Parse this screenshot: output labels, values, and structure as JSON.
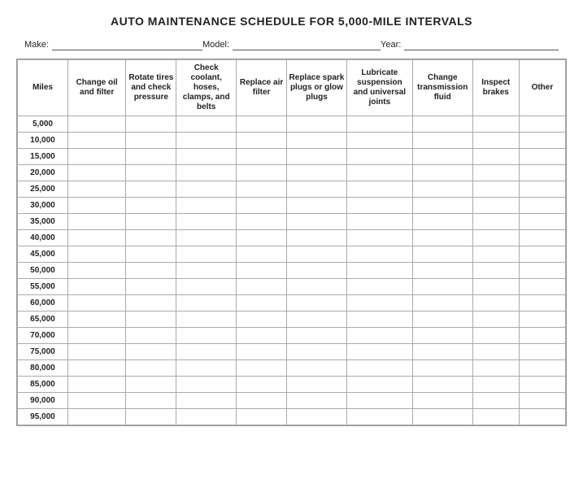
{
  "title": "AUTO MAINTENANCE SCHEDULE FOR 5,000-MILE INTERVALS",
  "header": {
    "make_label": "Make:",
    "model_label": "Model:",
    "year_label": "Year:"
  },
  "columns": [
    {
      "id": "miles",
      "label": "Miles"
    },
    {
      "id": "change_oil",
      "label": "Change oil and filter"
    },
    {
      "id": "rotate_tires",
      "label": "Rotate tires and check pressure"
    },
    {
      "id": "check_coolant",
      "label": "Check coolant, hoses, clamps, and belts"
    },
    {
      "id": "replace_air",
      "label": "Replace air filter"
    },
    {
      "id": "replace_spark",
      "label": "Replace spark plugs or glow plugs"
    },
    {
      "id": "lubricate",
      "label": "Lubricate suspension and universal joints"
    },
    {
      "id": "change_trans",
      "label": "Change transmission fluid"
    },
    {
      "id": "inspect_brakes",
      "label": "Inspect brakes"
    },
    {
      "id": "other",
      "label": "Other"
    }
  ],
  "rows": [
    "5,000",
    "10,000",
    "15,000",
    "20,000",
    "25,000",
    "30,000",
    "35,000",
    "40,000",
    "45,000",
    "50,000",
    "55,000",
    "60,000",
    "65,000",
    "70,000",
    "75,000",
    "80,000",
    "85,000",
    "90,000",
    "95,000"
  ]
}
